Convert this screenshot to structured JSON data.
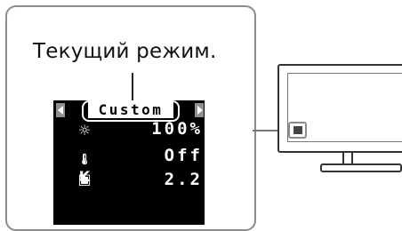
{
  "caption": "Текущий режим.",
  "osd": {
    "mode": "Custom",
    "rows": [
      {
        "icon": "brightness-icon",
        "glyph": "☼",
        "value": "100%"
      },
      {
        "icon": "color-temperature-icon",
        "glyph": "K",
        "value": "Off"
      },
      {
        "icon": "gamma-icon",
        "glyph": "▣",
        "value": "2.2"
      }
    ]
  },
  "colors": {
    "callout_border": "#8c8c8c",
    "osd_background": "#000000",
    "osd_text": "#ffffff",
    "arrow_gray": "#8f8f8f"
  }
}
